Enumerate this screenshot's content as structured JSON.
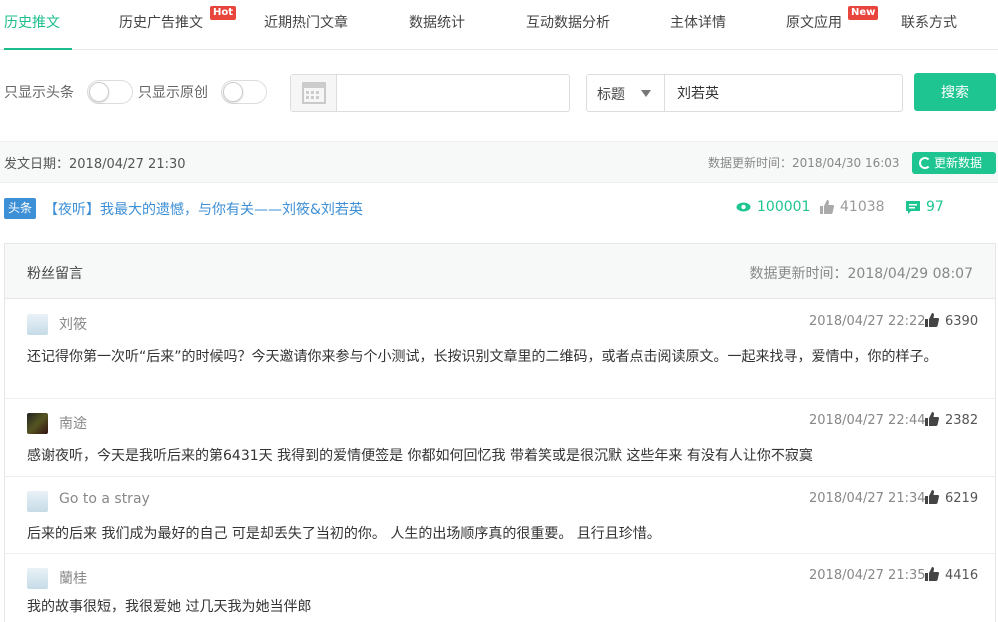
{
  "tabs": [
    {
      "label": "历史推文",
      "active": true
    },
    {
      "label": "历史广告推文",
      "badge": "Hot"
    },
    {
      "label": "近期热门文章"
    },
    {
      "label": "数据统计"
    },
    {
      "label": "互动数据分析"
    },
    {
      "label": "主体详情"
    },
    {
      "label": "原文应用",
      "badge": "New"
    },
    {
      "label": "联系方式"
    }
  ],
  "filters": {
    "headline_only": "只显示头条",
    "original_only": "只显示原创",
    "date_value": "",
    "field_select": "标题",
    "keyword": "刘若英",
    "search_button": "搜索"
  },
  "info": {
    "publish_date": "发文日期：2018/04/27 21:30",
    "update_time": "数据更新时间：2018/04/30 16:03",
    "refresh_button": "更新数据"
  },
  "article": {
    "tag": "头条",
    "title": "【夜听】我最大的遗憾，与你有关——刘筱&刘若英",
    "views": "100001",
    "likes": "41038",
    "comments": "97"
  },
  "comments_panel": {
    "title": "粉丝留言",
    "update_time": "数据更新时间：2018/04/29 08:07",
    "items": [
      {
        "name": "刘筱",
        "time": "2018/04/27 22:22",
        "likes": "6390",
        "text": "还记得你第一次听“后来”的时候吗？今天邀请你来参与个小测试，长按识别文章里的二维码，或者点击阅读原文。一起来找寻，爱情中，你的样子。"
      },
      {
        "name": "南途",
        "time": "2018/04/27 22:44",
        "likes": "2382",
        "text": "感谢夜听，今天是我听后来的第6431天 我得到的爱情便签是 你都如何回忆我 带着笑或是很沉默 这些年来 有没有人让你不寂寞"
      },
      {
        "name": "Go to a stray",
        "time": "2018/04/27 21:34",
        "likes": "6219",
        "text": "后来的后来 我们成为最好的自己 可是却丢失了当初的你。 人生的出场顺序真的很重要。 且行且珍惜。"
      },
      {
        "name": "蘭桂",
        "time": "2018/04/27 21:35",
        "likes": "4416",
        "text": "我的故事很短，我很爱她 过几天我为她当伴郎"
      }
    ]
  },
  "colors": {
    "accent": "#1ec590",
    "link": "#3d8fd6",
    "hot": "#e8463d"
  }
}
